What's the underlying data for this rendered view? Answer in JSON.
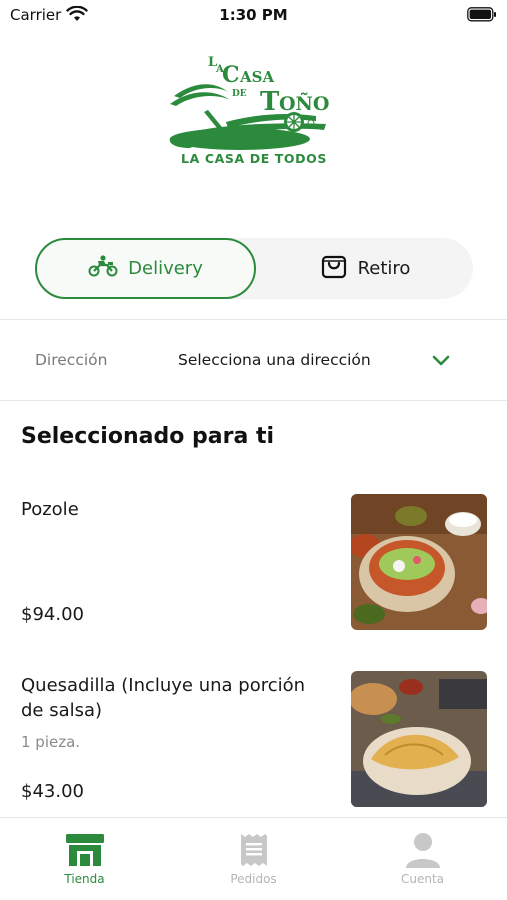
{
  "status_bar": {
    "carrier": "Carrier",
    "time": "1:30 PM"
  },
  "brand": {
    "logo_text": "LA CASA DE TOÑO",
    "tagline": "LA CASA DE TODOS",
    "color": "#2c8a3d"
  },
  "mode_toggle": {
    "selected": "Delivery",
    "options": [
      {
        "label": "Delivery",
        "icon": "motorcycle-icon"
      },
      {
        "label": "Retiro",
        "icon": "shopping-bag-icon"
      }
    ]
  },
  "address": {
    "label": "Dirección",
    "value": "Selecciona una dirección",
    "icon": "chevron-down-icon"
  },
  "section": {
    "title": "Seleccionado para ti"
  },
  "products": [
    {
      "name": "Pozole",
      "description": "",
      "price": "$94.00",
      "image": "pozole-bowl-photo"
    },
    {
      "name": "Quesadilla (Incluye una porción de salsa)",
      "description": "1 pieza.",
      "price": "$43.00",
      "image": "quesadilla-plate-photo"
    }
  ],
  "tabs": [
    {
      "label": "Tienda",
      "icon": "store-icon",
      "active": true
    },
    {
      "label": "Pedidos",
      "icon": "receipt-icon",
      "active": false
    },
    {
      "label": "Cuenta",
      "icon": "user-icon",
      "active": false
    }
  ],
  "colors": {
    "accent": "#2c8a3d",
    "muted_text": "#7a7a7a",
    "inactive_tab": "#b5b5b5"
  }
}
